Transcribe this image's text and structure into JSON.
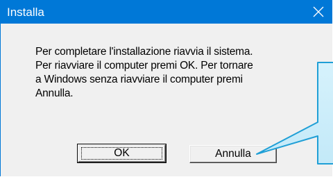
{
  "window": {
    "title": "Installa"
  },
  "icons": {
    "close": "close-icon"
  },
  "message": {
    "lines": [
      "Per completare l'installazione riavvia il sistema.",
      "Per riavviare il computer premi OK. Per tornare",
      "a Windows senza riavviare il computer premi",
      "Annulla."
    ]
  },
  "buttons": {
    "ok_label": "OK",
    "cancel_label": "Annulla"
  },
  "colors": {
    "titlebar": "#0078d7",
    "dialog_bg": "#f0f0f0",
    "callout_fill": "#cdeefb",
    "callout_border": "#1f9fd6"
  }
}
